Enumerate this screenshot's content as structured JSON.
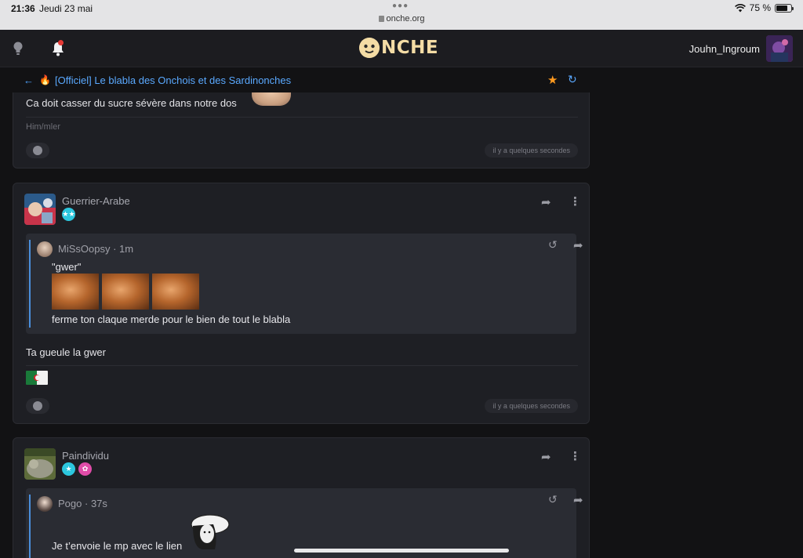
{
  "status_bar": {
    "time": "21:36",
    "date": "Jeudi 23 mai",
    "url": "onche.org",
    "battery": "75 %",
    "battery_level": 0.75
  },
  "header": {
    "logo_text": "NCHE",
    "username": "Jouhn_Ingroum"
  },
  "topic": {
    "title": "[Officiel] Le blabla des Onchois et des Sardinonches"
  },
  "posts": [
    {
      "text": "Ca doit casser du sucre sévère dans notre dos",
      "signature": "Him/mler",
      "time": "il y a quelques secondes"
    },
    {
      "author": "Guerrier-Arabe",
      "quote_author": "MiSsOopsy",
      "quote_time": "1m",
      "quote_line1": "\"gwer\"",
      "quote_line2": "ferme ton claque merde pour le bien de tout le blabla",
      "text": "Ta gueule la gwer",
      "time": "il y a quelques secondes"
    },
    {
      "author": "Paindividu",
      "quote_author": "Pogo",
      "quote_time": "37s",
      "quote_line1": "Je t’envoie le mp avec le lien"
    }
  ],
  "colors": {
    "accent_blue": "#5aa9ff",
    "star_orange": "#ff9a1f",
    "logo_cream": "#f4dca5",
    "badge_cyan": "#2cc7de",
    "badge_pink": "#e04ca8"
  }
}
